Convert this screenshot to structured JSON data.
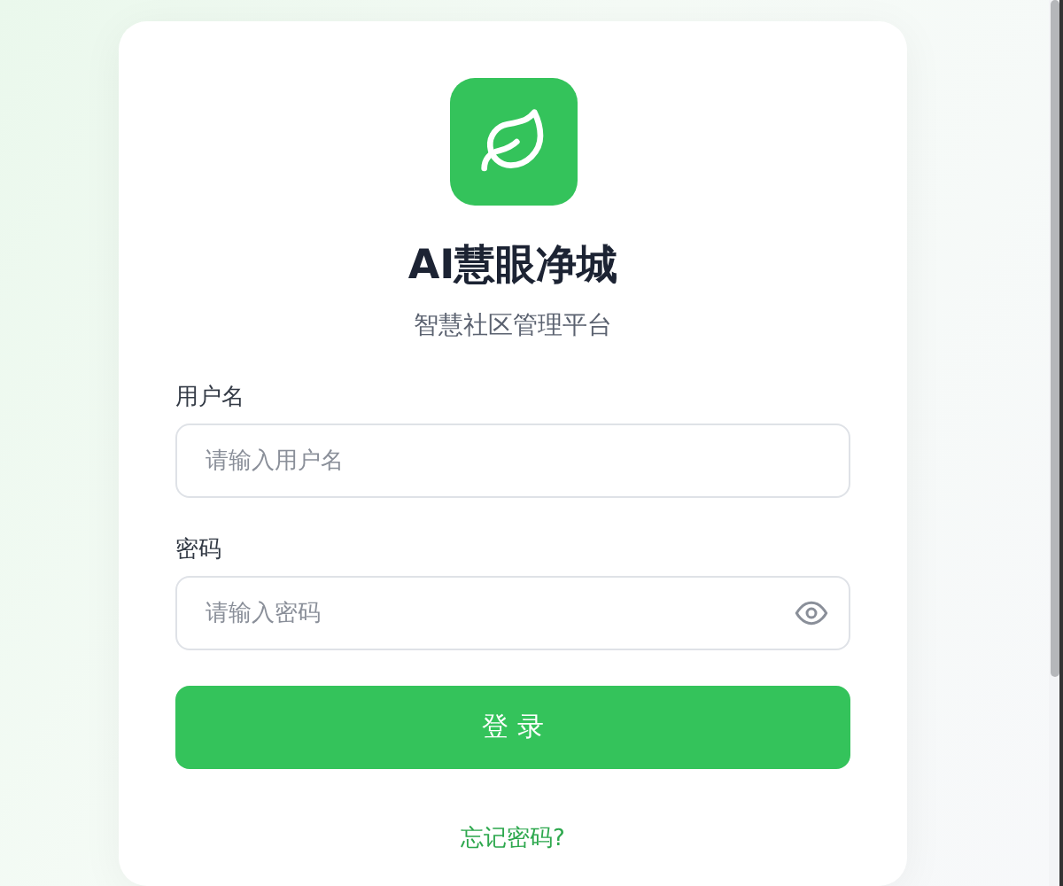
{
  "app": {
    "title": "AI慧眼净城",
    "subtitle": "智慧社区管理平台"
  },
  "fields": [
    {
      "label": "用户名",
      "placeholder": "请输入用户名",
      "kind": "text"
    },
    {
      "label": "密码",
      "placeholder": "请输入密码",
      "kind": "password"
    }
  ],
  "login_button": "登 录",
  "forgot_link": "忘记密码?"
}
